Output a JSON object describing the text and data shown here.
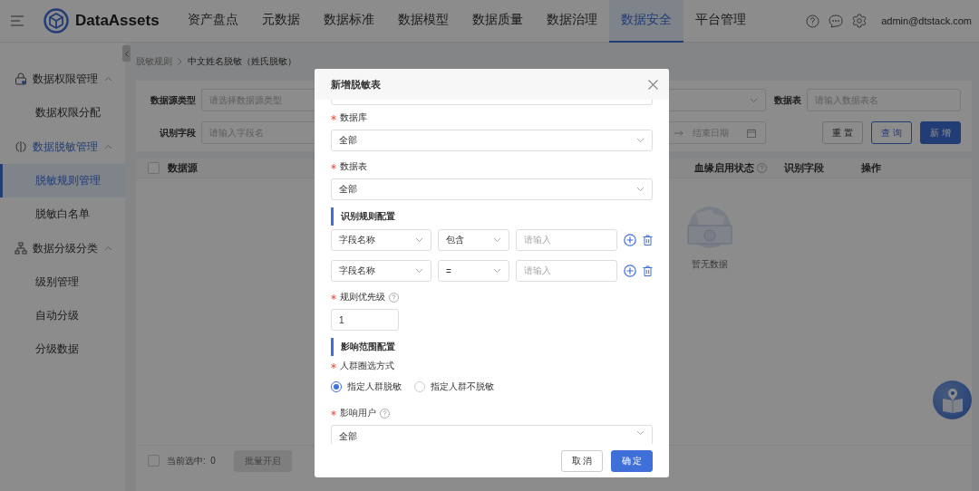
{
  "header": {
    "brand": "DataAssets",
    "nav": [
      {
        "label": "资产盘点",
        "selected": false
      },
      {
        "label": "元数据",
        "selected": false
      },
      {
        "label": "数据标准",
        "selected": false
      },
      {
        "label": "数据模型",
        "selected": false
      },
      {
        "label": "数据质量",
        "selected": false
      },
      {
        "label": "数据治理",
        "selected": false
      },
      {
        "label": "数据安全",
        "selected": true
      },
      {
        "label": "平台管理",
        "selected": false
      }
    ],
    "user": "admin@dtstack.com"
  },
  "sidebar": {
    "groups": [
      {
        "label": "数据权限管理",
        "active": false,
        "expanded": true,
        "items": [
          {
            "label": "数据权限分配",
            "selected": false
          }
        ]
      },
      {
        "label": "数据脱敏管理",
        "active": true,
        "expanded": true,
        "items": [
          {
            "label": "脱敏规则管理",
            "selected": true
          },
          {
            "label": "脱敏白名单",
            "selected": false
          }
        ]
      },
      {
        "label": "数据分级分类",
        "active": false,
        "expanded": true,
        "items": [
          {
            "label": "级别管理",
            "selected": false
          },
          {
            "label": "自动分级",
            "selected": false
          },
          {
            "label": "分级数据",
            "selected": false
          }
        ]
      }
    ]
  },
  "breadcrumb": [
    "脱敏规则",
    "中文姓名脱敏（姓氏脱敏）"
  ],
  "filters": {
    "source_type": {
      "label": "数据源类型",
      "placeholder": "请选择数据源类型"
    },
    "table": {
      "label": "数据表",
      "placeholder": "请输入数据表名"
    },
    "field": {
      "label": "识别字段",
      "placeholder": "请输入字段名"
    },
    "end_date": {
      "placeholder": "结束日期"
    },
    "buttons": [
      {
        "label": "重 置",
        "kind": "default"
      },
      {
        "label": "查 询",
        "kind": "outline"
      },
      {
        "label": "新 增",
        "kind": "primary"
      }
    ]
  },
  "table": {
    "select_all": {
      "checked": false
    },
    "columns": [
      {
        "label": "数据源",
        "help": false
      },
      {
        "label": "血缘启用状态",
        "help": true
      },
      {
        "label": "识别字段",
        "help": false
      },
      {
        "label": "操作",
        "help": false
      }
    ],
    "empty_text": "暂无数据"
  },
  "footer": {
    "checkbox": {
      "checked": false
    },
    "selected_count": "当前选中:  0",
    "buttons": [
      {
        "label": "批量开启",
        "disabled": true
      }
    ]
  },
  "modal": {
    "title": "新增脱敏表",
    "database": {
      "label": "数据库",
      "required": true,
      "value": "全部"
    },
    "table": {
      "label": "数据表",
      "required": true,
      "value": "全部"
    },
    "rules_section": "识别规则配置",
    "rules": [
      {
        "field": "字段名称",
        "operator": "包含",
        "placeholder": "请输入"
      },
      {
        "field": "字段名称",
        "operator": "=",
        "placeholder": "请输入"
      }
    ],
    "priority": {
      "label": "规则优先级",
      "required": true,
      "help": true,
      "value": "1"
    },
    "scope_section": "影响范围配置",
    "crowd": {
      "label": "人群圈选方式",
      "required": true,
      "options": [
        {
          "label": "指定人群脱敏",
          "selected": true
        },
        {
          "label": "指定人群不脱敏",
          "selected": false
        }
      ]
    },
    "users": {
      "label": "影响用户",
      "required": true,
      "help": true,
      "value": "全部"
    },
    "buttons": [
      {
        "label": "取 消",
        "kind": "default"
      },
      {
        "label": "确 定",
        "kind": "primary"
      }
    ]
  }
}
